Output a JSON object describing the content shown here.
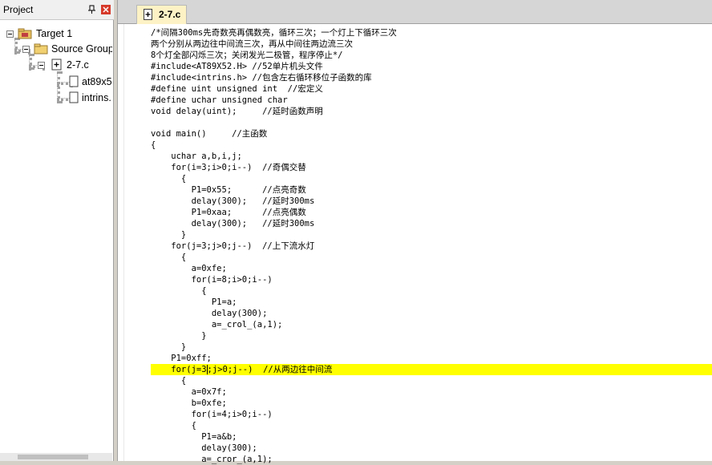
{
  "project_panel": {
    "title": "Project",
    "tree": [
      {
        "label": "Target 1",
        "level": 0
      },
      {
        "label": "Source Group",
        "level": 1
      },
      {
        "label": "2-7.c",
        "level": 2
      },
      {
        "label": "at89x5",
        "level": 3
      },
      {
        "label": "intrins.",
        "level": 3
      }
    ]
  },
  "editor": {
    "tab_label": "2-7.c",
    "lines": [
      "/*间隔300ms先奇数亮再偶数亮，循环三次；一个灯上下循环三次",
      "两个分别从两边往中间流三次，再从中间往两边流三次",
      "8个灯全部闪烁三次；关闭发光二极管，程序停止*/",
      "#include<AT89X52.H> //52单片机头文件",
      "#include<intrins.h> //包含左右循环移位子函数的库",
      "#define uint unsigned int  //宏定义",
      "#define uchar unsigned char",
      "void delay(uint);     //延时函数声明",
      "",
      "void main()     //主函数",
      "{",
      "    uchar a,b,i,j;",
      "    for(i=3;i>0;i--)  //奇偶交替",
      "      {",
      "        P1=0x55;      //点亮奇数",
      "        delay(300);   //延时300ms",
      "        P1=0xaa;      //点亮偶数",
      "        delay(300);   //延时300ms",
      "      }",
      "    for(j=3;j>0;j--)  //上下流水灯",
      "      {",
      "        a=0xfe;",
      "        for(i=8;i>0;i--)",
      "          {",
      "            P1=a;",
      "            delay(300);",
      "            a=_crol_(a,1);",
      "          }",
      "      }",
      "    P1=0xff;",
      "    for(j=3;j>0;j--)  //从两边往中间流",
      "      {",
      "        a=0x7f;",
      "        b=0xfe;",
      "        for(i=4;i>0;i--)",
      "        {",
      "          P1=a&b;",
      "          delay(300);",
      "          a=_cror_(a,1);"
    ]
  }
}
